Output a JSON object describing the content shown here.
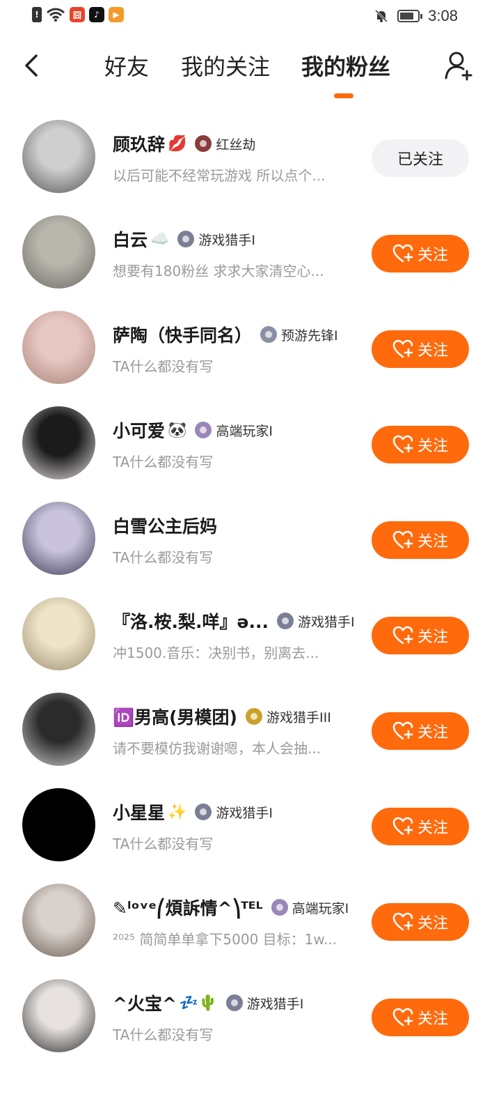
{
  "status_bar": {
    "time": "3:08",
    "left_icons": [
      "alert-icon",
      "wifi-icon",
      "app-red-icon",
      "tiktok-icon",
      "video-play-icon"
    ],
    "right_icons": [
      "mute-icon",
      "battery-icon"
    ],
    "battery_level": 0.8
  },
  "header": {
    "tabs": [
      {
        "label": "好友",
        "active": false
      },
      {
        "label": "我的关注",
        "active": false
      },
      {
        "label": "我的粉丝",
        "active": true
      }
    ]
  },
  "colors": {
    "accent": "#ff6a0d",
    "followed_bg": "#f2f2f4",
    "muted_text": "#9a9a9a"
  },
  "fans": [
    {
      "name": "顾玖辞",
      "name_emoji": "💋",
      "badge": "红丝劫",
      "badge_color": "#8a3b3b",
      "bio": "以后可能不经常玩游戏 所以点个...",
      "button": "已关注",
      "followed": true,
      "avatar_colors": [
        "#cfcfcf",
        "#555555"
      ]
    },
    {
      "name": "白云",
      "name_emoji": "☁️",
      "badge": "游戏猎手I",
      "badge_color": "#7a7f95",
      "bio": "想要有180粉丝 求求大家清空心...",
      "button": "关注",
      "followed": false,
      "avatar_colors": [
        "#b9b6ae",
        "#6d6a63"
      ]
    },
    {
      "name": "萨陶（快手同名）",
      "name_emoji": "",
      "badge": "预游先锋I",
      "badge_color": "#8a8fa3",
      "bio": "TA什么都没有写",
      "button": "关注",
      "followed": false,
      "avatar_colors": [
        "#e7c7c4",
        "#a98476"
      ]
    },
    {
      "name": "小可爱",
      "name_emoji": "🐼",
      "badge": "高端玩家I",
      "badge_color": "#9a86b8",
      "bio": "TA什么都没有写",
      "button": "关注",
      "followed": false,
      "avatar_colors": [
        "#1b1b1b",
        "#e9e3e2"
      ]
    },
    {
      "name": "白雪公主后妈",
      "name_emoji": "",
      "badge": "",
      "badge_color": "",
      "bio": "TA什么都没有写",
      "button": "关注",
      "followed": false,
      "avatar_colors": [
        "#c9c4dc",
        "#3c3a55"
      ]
    },
    {
      "name": "『洛.桉.梨.咩』ə...",
      "name_emoji": "",
      "badge": "游戏猎手I",
      "badge_color": "#7a7f95",
      "bio": "冲1500.音乐：决别书，别离去...",
      "button": "关注",
      "followed": false,
      "avatar_colors": [
        "#efe4c8",
        "#9c8e6f"
      ]
    },
    {
      "name": "🆔男高(男模团)",
      "name_emoji": "",
      "badge": "游戏猎手III",
      "badge_color": "#c9a22a",
      "bio": "请不要模仿我谢谢嗯，本人会抽...",
      "button": "关注",
      "followed": false,
      "avatar_colors": [
        "#2b2b2b",
        "#cfcfcf"
      ]
    },
    {
      "name": "小星星",
      "name_emoji": "✨",
      "badge": "游戏猎手I",
      "badge_color": "#7a7f95",
      "bio": "TA什么都没有写",
      "button": "关注",
      "followed": false,
      "avatar_colors": [
        "#000000",
        "#000000"
      ]
    },
    {
      "name": "✎ˡᵒᵛᵉ⎛煩訴情^⎞ᵀᴱᴸ",
      "name_emoji": "",
      "badge": "高端玩家I",
      "badge_color": "#9a86b8",
      "bio": "²⁰²⁵ 简简单单拿下5000 目标：1w...",
      "button": "关注",
      "followed": false,
      "avatar_colors": [
        "#d9d2cc",
        "#6b5c52"
      ]
    },
    {
      "name": "^火宝^",
      "name_emoji": "💤🌵",
      "badge": "游戏猎手I",
      "badge_color": "#7a7f95",
      "bio": "TA什么都没有写",
      "button": "关注",
      "followed": false,
      "avatar_colors": [
        "#e7e2df",
        "#2c2c2c"
      ]
    }
  ]
}
